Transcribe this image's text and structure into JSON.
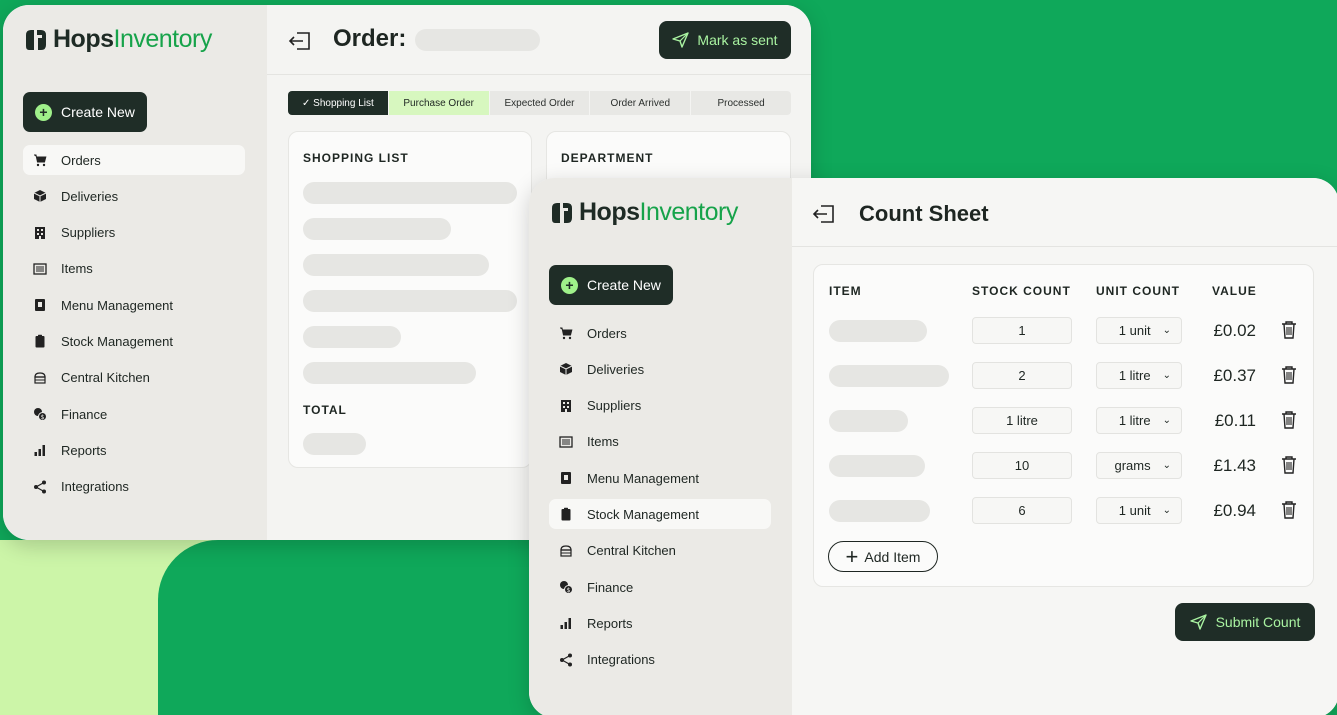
{
  "brand": {
    "name_bold": "Hops",
    "name_light": "Inventory"
  },
  "colors": {
    "accent_green": "#16a34a",
    "dark": "#1f2d27",
    "light_green": "#9ff08a",
    "background": "#0fa85a"
  },
  "sidebar": {
    "create_new": "Create New",
    "items": [
      {
        "label": "Orders",
        "icon": "cart-icon"
      },
      {
        "label": "Deliveries",
        "icon": "box-icon"
      },
      {
        "label": "Suppliers",
        "icon": "building-icon"
      },
      {
        "label": "Items",
        "icon": "list-icon"
      },
      {
        "label": "Menu Management",
        "icon": "menu-book-icon"
      },
      {
        "label": "Stock Management",
        "icon": "clipboard-icon"
      },
      {
        "label": "Central Kitchen",
        "icon": "kitchen-icon"
      },
      {
        "label": "Finance",
        "icon": "coins-icon"
      },
      {
        "label": "Reports",
        "icon": "bar-chart-icon"
      },
      {
        "label": "Integrations",
        "icon": "share-icon"
      }
    ]
  },
  "order_window": {
    "title": "Order:",
    "active_nav": "Orders",
    "mark_as_sent": "Mark as sent",
    "steps": [
      {
        "label": "✓ Shopping List",
        "state": "done"
      },
      {
        "label": "Purchase Order",
        "state": "current"
      },
      {
        "label": "Expected Order",
        "state": "pending"
      },
      {
        "label": "Order Arrived",
        "state": "pending"
      },
      {
        "label": "Processed",
        "state": "pending"
      }
    ],
    "shopping_list_heading": "SHOPPING LIST",
    "department_heading": "DEPARTMENT",
    "total_heading": "TOTAL"
  },
  "count_window": {
    "title": "Count Sheet",
    "active_nav": "Stock Management",
    "columns": [
      "ITEM",
      "STOCK COUNT",
      "UNIT COUNT",
      "VALUE"
    ],
    "rows": [
      {
        "stock": "1",
        "unit": "1 unit",
        "value": "£0.02"
      },
      {
        "stock": "2",
        "unit": "1 litre",
        "value": "£0.37"
      },
      {
        "stock": "1 litre",
        "unit": "1 litre",
        "value": "£0.11"
      },
      {
        "stock": "10",
        "unit": "grams",
        "value": "£1.43"
      },
      {
        "stock": "6",
        "unit": "1 unit",
        "value": "£0.94"
      }
    ],
    "add_item": "Add Item",
    "submit": "Submit Count"
  }
}
